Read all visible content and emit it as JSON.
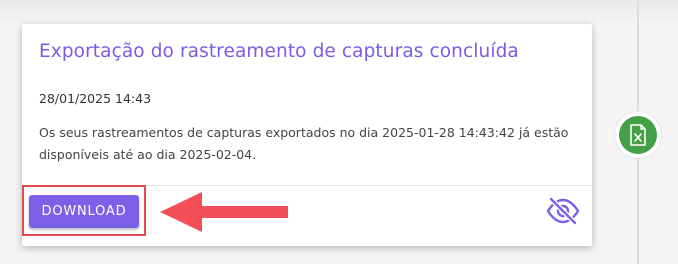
{
  "notification": {
    "title": "Exportação do rastreamento de capturas concluída",
    "date": "28/01/2025 14:43",
    "message": "Os seus rastreamentos de capturas exportados no dia 2025-01-28 14:43:42 já estão disponíveis até ao dia 2025-02-04.",
    "download_label": "DOWNLOAD"
  },
  "icons": {
    "hide": "eye-off-icon",
    "excel": "excel-file-icon",
    "arrow": "left-arrow-annotation"
  },
  "colors": {
    "accent": "#7b61e8",
    "title": "#7b5be5",
    "annotation_red": "#e24b50",
    "excel_green": "#43a047"
  }
}
